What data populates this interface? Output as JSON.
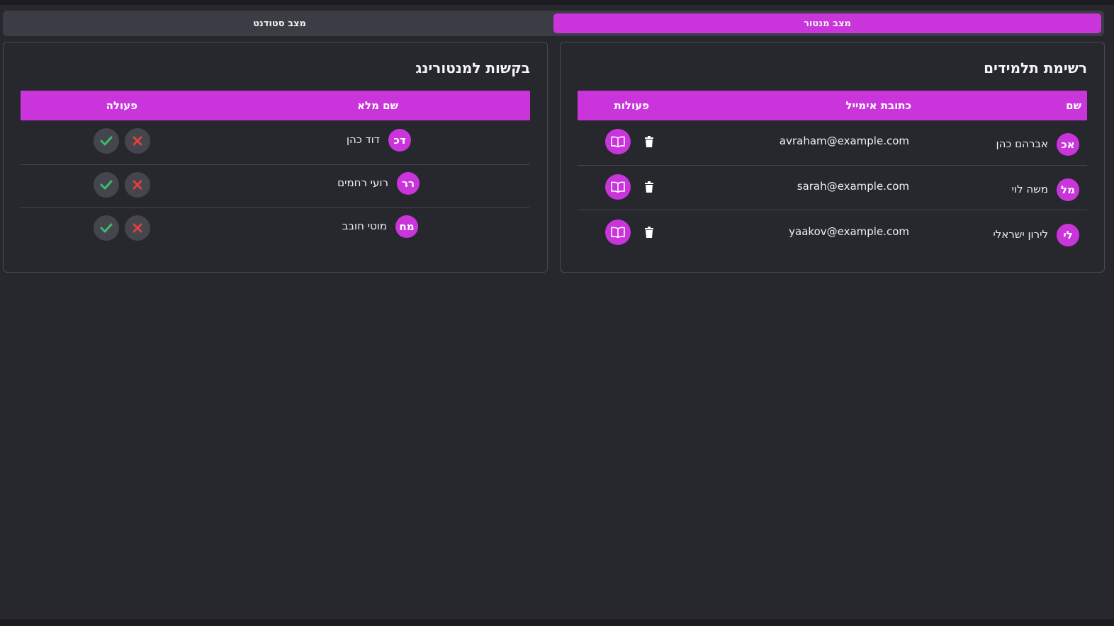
{
  "mode_switch": {
    "mentor_label": "מצב מנטור",
    "student_label": "מצב סטודנט",
    "active": "mentor"
  },
  "students_panel": {
    "title": "רשימת תלמידים",
    "columns": {
      "name": "שם",
      "email": "כתובת אימייל",
      "actions": "פעולות"
    },
    "rows": [
      {
        "initials": "אכ",
        "name": "אברהם כהן",
        "email": "avraham@example.com"
      },
      {
        "initials": "מל",
        "name": "משה לוי",
        "email": "sarah@example.com"
      },
      {
        "initials": "לי",
        "name": "לירון ישראלי",
        "email": "yaakov@example.com"
      }
    ]
  },
  "requests_panel": {
    "title": "בקשות למנטורינג",
    "columns": {
      "full_name": "שם מלא",
      "action": "פעולה"
    },
    "rows": [
      {
        "initials": "דכ",
        "name": "דוד כהן"
      },
      {
        "initials": "רר",
        "name": "רועי רחמים"
      },
      {
        "initials": "מח",
        "name": "מוטי חובב"
      }
    ]
  },
  "colors": {
    "accent": "#c935db",
    "background": "#27282d",
    "approve": "#3dbb6a",
    "reject": "#e0403d"
  }
}
